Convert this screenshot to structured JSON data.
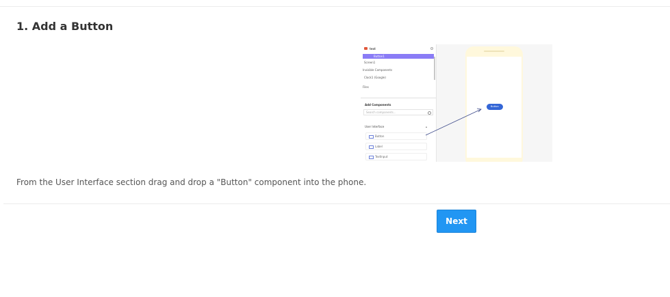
{
  "step": {
    "title": "1. Add a Button",
    "instruction": "From the User Interface section drag and drop a \"Button\" component into the phone."
  },
  "illustration": {
    "project_name": "test",
    "selected_component": "Button1",
    "tree": {
      "screen": "Screen1",
      "invisible_components": "Invisible Components",
      "clock": "Clock1 (Google)",
      "files": "Files"
    },
    "add_components": {
      "title": "Add Components",
      "search_placeholder": "Search components...",
      "section": "User Interface",
      "items": [
        "Button",
        "Label",
        "TextInput"
      ]
    },
    "phone_button_label": "Button",
    "colors": {
      "selection": "#8a7cf6",
      "phone_frame": "#fff8dc",
      "phone_button": "#3466d6"
    }
  },
  "footer": {
    "next_label": "Next",
    "next_color": "#2196f3"
  }
}
